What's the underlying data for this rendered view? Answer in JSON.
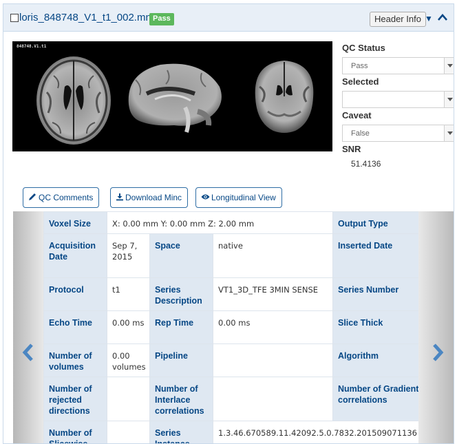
{
  "header": {
    "filename": "loris_848748_V1_t1_002.mnc",
    "badge": "Pass",
    "badge_color": "#5cb85c",
    "header_info_label": "Header Info",
    "caret": "▼"
  },
  "viewer": {
    "overlay_label": "848748.V1.t1"
  },
  "qc": {
    "status_label": "QC Status",
    "status_value": "Pass",
    "selected_label": "Selected",
    "selected_value": "",
    "caveat_label": "Caveat",
    "caveat_value": "False",
    "snr_label": "SNR",
    "snr_value": "51.4136"
  },
  "buttons": {
    "qc_comments": "QC Comments",
    "download_minc": "Download Minc",
    "longitudinal_view": "Longitudinal View"
  },
  "icons": {
    "qc_comments": "pencil-icon",
    "download_minc": "download-icon",
    "longitudinal_view": "eye-icon",
    "prev": "chevron-left-icon",
    "next": "chevron-right-icon"
  },
  "info_table": {
    "rows": [
      [
        {
          "t": "l",
          "text": "Voxel Size"
        },
        {
          "t": "v",
          "text": "X: 0.00 mm Y: 0.00 mm Z: 2.00 mm",
          "span": 3
        },
        {
          "t": "l",
          "text": "Output Type"
        }
      ],
      [
        {
          "t": "l",
          "text": "Acquisition Date"
        },
        {
          "t": "v",
          "text": "Sep 7, 2015"
        },
        {
          "t": "l",
          "text": "Space"
        },
        {
          "t": "v",
          "text": "native"
        },
        {
          "t": "l",
          "text": "Inserted Date"
        }
      ],
      [
        {
          "t": "l",
          "text": "Protocol"
        },
        {
          "t": "v",
          "text": "t1"
        },
        {
          "t": "l",
          "text": "Series Description"
        },
        {
          "t": "v",
          "text": "VT1_3D_TFE 3MIN SENSE"
        },
        {
          "t": "l",
          "text": "Series Number"
        }
      ],
      [
        {
          "t": "l",
          "text": "Echo Time"
        },
        {
          "t": "v",
          "text": "0.00 ms"
        },
        {
          "t": "l",
          "text": "Rep Time"
        },
        {
          "t": "v",
          "text": "0.00 ms"
        },
        {
          "t": "l",
          "text": "Slice Thick"
        }
      ],
      [
        {
          "t": "l",
          "text": "Number of volumes"
        },
        {
          "t": "v",
          "text": "0.00 volumes"
        },
        {
          "t": "l",
          "text": "Pipeline"
        },
        {
          "t": "v",
          "text": ""
        },
        {
          "t": "l",
          "text": "Algorithm"
        }
      ],
      [
        {
          "t": "l",
          "text": "Number of rejected directions"
        },
        {
          "t": "v",
          "text": ""
        },
        {
          "t": "l",
          "text": "Number of Interlace correlations"
        },
        {
          "t": "v",
          "text": ""
        },
        {
          "t": "l",
          "text": "Number of Gradient correlations"
        }
      ],
      [
        {
          "t": "l",
          "text": "Number of Slicewise"
        },
        {
          "t": "v",
          "text": ""
        },
        {
          "t": "l",
          "text": "Series Instance"
        },
        {
          "t": "v",
          "text": "1.3.46.670589.11.42092.5.0.7832.201509071136",
          "span": 2,
          "nowrap": true
        }
      ]
    ]
  }
}
